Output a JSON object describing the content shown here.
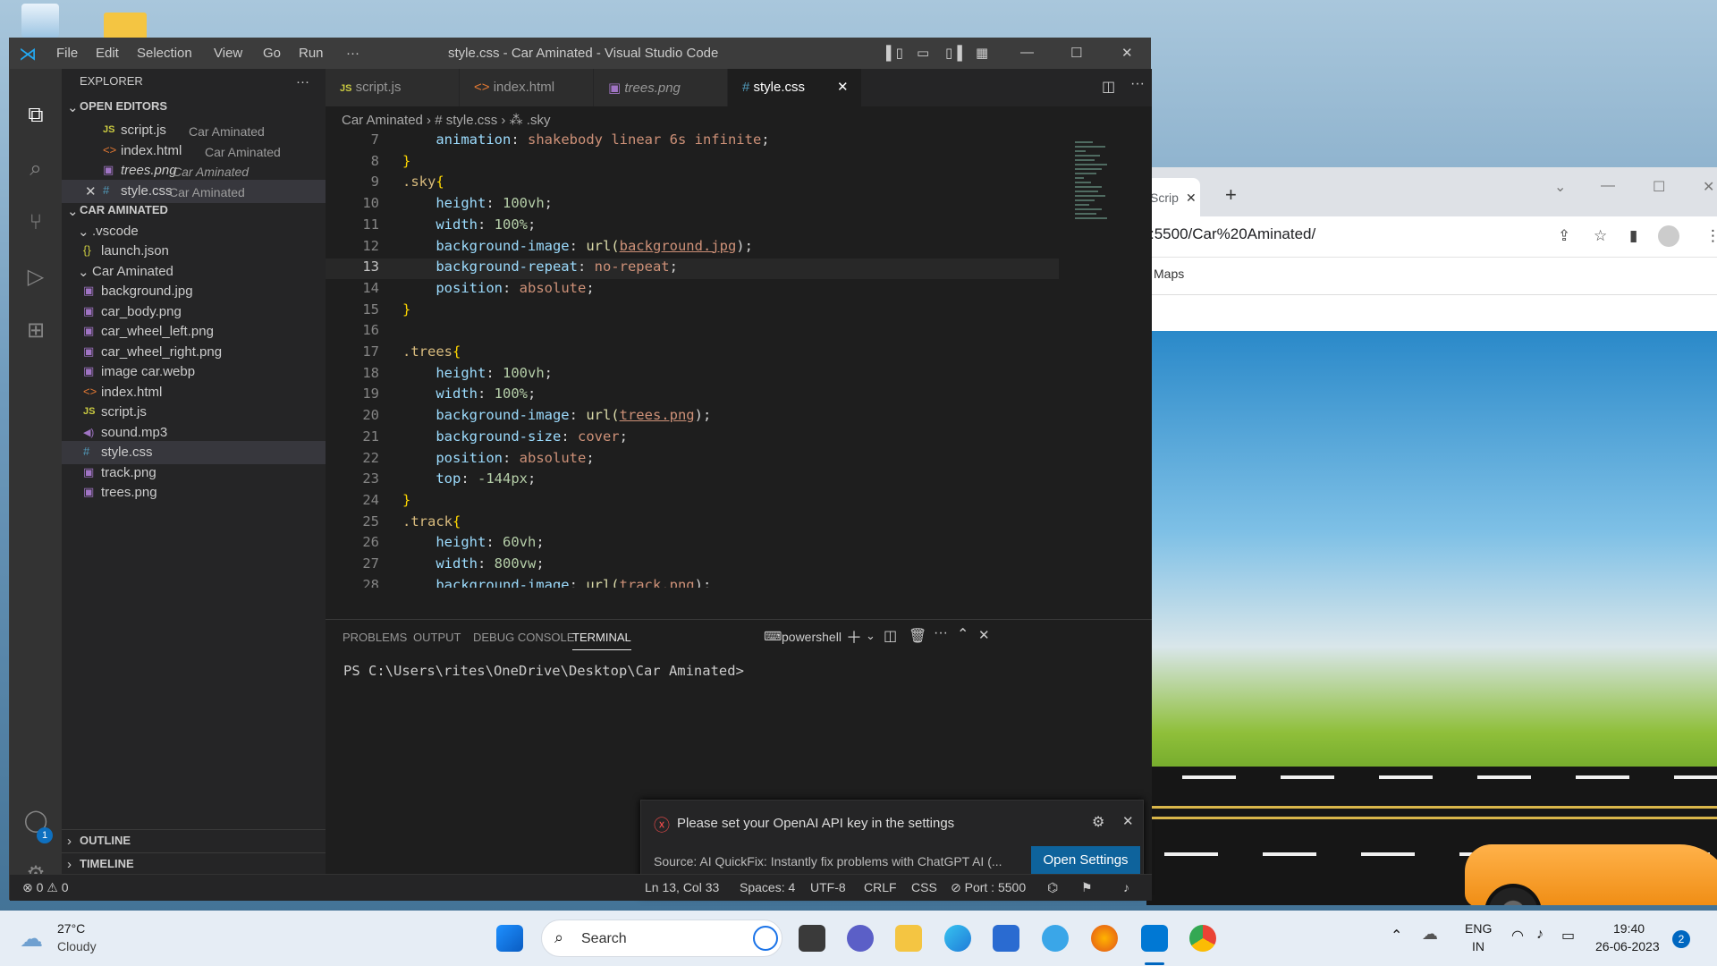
{
  "vscode": {
    "title": "style.css - Car Aminated - Visual Studio Code",
    "menu": [
      "File",
      "Edit",
      "Selection",
      "View",
      "Go",
      "Run",
      "···"
    ],
    "explorer_title": "EXPLORER",
    "explorer_more": "···",
    "open_editors_header": "OPEN EDITORS",
    "open_editors": [
      {
        "icon": "JS",
        "name": "script.js",
        "desc": "Car Aminated"
      },
      {
        "icon": "<>",
        "name": "index.html",
        "desc": "Car Aminated"
      },
      {
        "icon": "▣",
        "name": "trees.png",
        "desc": "Car Aminated"
      },
      {
        "icon": "#",
        "name": "style.css",
        "desc": "Car Aminated",
        "close": "✕"
      }
    ],
    "project_header": "CAR AMINATED",
    "tree": [
      {
        "icon": "",
        "name": ".vscode"
      },
      {
        "icon": "{}",
        "name": "launch.json"
      },
      {
        "icon": "",
        "name": "Car Aminated"
      },
      {
        "icon": "▣",
        "name": "background.jpg"
      },
      {
        "icon": "▣",
        "name": "car_body.png"
      },
      {
        "icon": "▣",
        "name": "car_wheel_left.png"
      },
      {
        "icon": "▣",
        "name": "car_wheel_right.png"
      },
      {
        "icon": "▣",
        "name": "image car.webp"
      },
      {
        "icon": "<>",
        "name": "index.html"
      },
      {
        "icon": "JS",
        "name": "script.js"
      },
      {
        "icon": "◀)",
        "name": "sound.mp3"
      },
      {
        "icon": "#",
        "name": "style.css"
      },
      {
        "icon": "▣",
        "name": "track.png"
      },
      {
        "icon": "▣",
        "name": "trees.png"
      }
    ],
    "outline": "OUTLINE",
    "timeline": "TIMELINE",
    "tabs": [
      {
        "icon": "JS",
        "label": "script.js"
      },
      {
        "icon": "<>",
        "label": "index.html"
      },
      {
        "icon": "▣",
        "label": "trees.png"
      },
      {
        "icon": "#",
        "label": "style.css",
        "close": "✕"
      }
    ],
    "breadcrumb": {
      "folder": "Car Aminated",
      "file": "# style.css",
      "symbol": "⁂ .sky"
    },
    "code_lines": [
      {
        "n": "7",
        "t": "    animation: shakebody linear 6s infinite;"
      },
      {
        "n": "8",
        "t": "}"
      },
      {
        "n": "9",
        "t": ".sky{"
      },
      {
        "n": "10",
        "t": "    height: 100vh;"
      },
      {
        "n": "11",
        "t": "    width: 100%;"
      },
      {
        "n": "12",
        "t": "    background-image: url(background.jpg);"
      },
      {
        "n": "13",
        "t": "    background-repeat: no-repeat;"
      },
      {
        "n": "14",
        "t": "    position: absolute;"
      },
      {
        "n": "15",
        "t": "}"
      },
      {
        "n": "16",
        "t": ""
      },
      {
        "n": "17",
        "t": ".trees{"
      },
      {
        "n": "18",
        "t": "    height: 100vh;"
      },
      {
        "n": "19",
        "t": "    width: 100%;"
      },
      {
        "n": "20",
        "t": "    background-image: url(trees.png);"
      },
      {
        "n": "21",
        "t": "    background-size: cover;"
      },
      {
        "n": "22",
        "t": "    position: absolute;"
      },
      {
        "n": "23",
        "t": "    top: -144px;"
      },
      {
        "n": "24",
        "t": "}"
      },
      {
        "n": "25",
        "t": ".track{"
      },
      {
        "n": "26",
        "t": "    height: 60vh;"
      },
      {
        "n": "27",
        "t": "    width: 800vw;"
      },
      {
        "n": "28",
        "t": "    background-image: url(track.png);"
      }
    ],
    "panel_tabs": [
      "PROBLEMS",
      "OUTPUT",
      "DEBUG CONSOLE",
      "TERMINAL"
    ],
    "terminal_shell": "powershell",
    "terminal_prompt": "PS C:\\Users\\rites\\OneDrive\\Desktop\\Car Aminated>",
    "notification": {
      "message": "Please set your OpenAI API key in the settings",
      "source": "Source: AI QuickFix: Instantly fix problems with ChatGPT AI (...",
      "button": "Open Settings"
    },
    "status": {
      "errors": "⊗ 0 ⚠ 0",
      "position": "Ln 13, Col 33",
      "spaces": "Spaces: 4",
      "encoding": "UTF-8",
      "eol": "CRLF",
      "language": "CSS",
      "port": "⊘ Port : 5500"
    },
    "accounts_badge": "1"
  },
  "browser": {
    "tab_label": "Scrip",
    "url": ":5500/Car%20Aminated/",
    "bookmark": "Maps"
  },
  "taskbar": {
    "weather_temp": "27°C",
    "weather_desc": "Cloudy",
    "search_placeholder": "Search",
    "lang": "ENG",
    "region": "IN",
    "time": "19:40",
    "date": "26-06-2023",
    "notif_count": "2"
  }
}
